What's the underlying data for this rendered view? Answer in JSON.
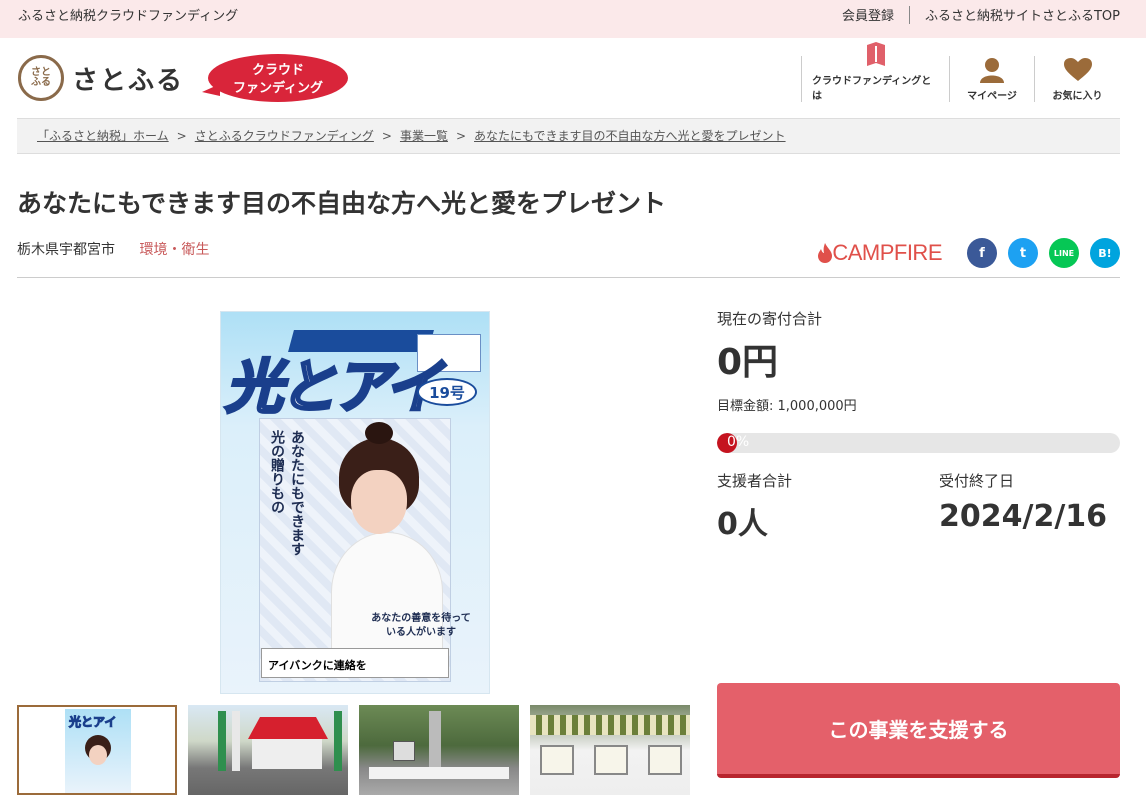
{
  "topbar": {
    "site_name": "ふるさと納税クラウドファンディング",
    "links": [
      "会員登録",
      "ふるさと納税サイトさとふるTOP"
    ]
  },
  "header": {
    "logo_mark": "さとふる",
    "logo_text": "さとふる",
    "badge_line1": "クラウド",
    "badge_line2": "ファンディング",
    "nav": [
      {
        "label": "クラウドファンディングとは",
        "icon": "book-icon"
      },
      {
        "label": "マイページ",
        "icon": "user-icon"
      },
      {
        "label": "お気に入り",
        "icon": "heart-icon"
      }
    ]
  },
  "breadcrumb": [
    "「ふるさと納税」ホーム",
    "さとふるクラウドファンディング",
    "事業一覧",
    "あなたにもできます目の不自由な方へ光と愛をプレゼント"
  ],
  "project": {
    "title": "あなたにもできます目の不自由な方へ光と愛をプレゼント",
    "municipality": "栃木県宇都宮市",
    "category": "環境・衛生"
  },
  "share": {
    "campfire": "CAMPFIRE",
    "buttons": [
      "f",
      "t",
      "LINE",
      "B!"
    ]
  },
  "poster": {
    "title_big": "光とアイ",
    "issue": "19号",
    "vertical1": "あなたにもできます",
    "vertical2": "光の贈りもの",
    "caption": "あなたの善意を待っている人がいます",
    "bottom": "アイバンクに連絡を"
  },
  "stats": {
    "current_label": "現在の寄付合計",
    "current_value": "0円",
    "target": "目標金額: 1,000,000円",
    "progress_text": "0%",
    "progress_pct": 0,
    "supporters_label": "支援者合計",
    "supporters_value": "0人",
    "deadline_label": "受付終了日",
    "deadline_value": "2024/2/16"
  },
  "support_button": "この事業を支援する",
  "colors": {
    "topbar_bg": "#fbe9ea",
    "accent_red": "#d9253a",
    "button": "#e4606a",
    "category": "#c8595a"
  }
}
